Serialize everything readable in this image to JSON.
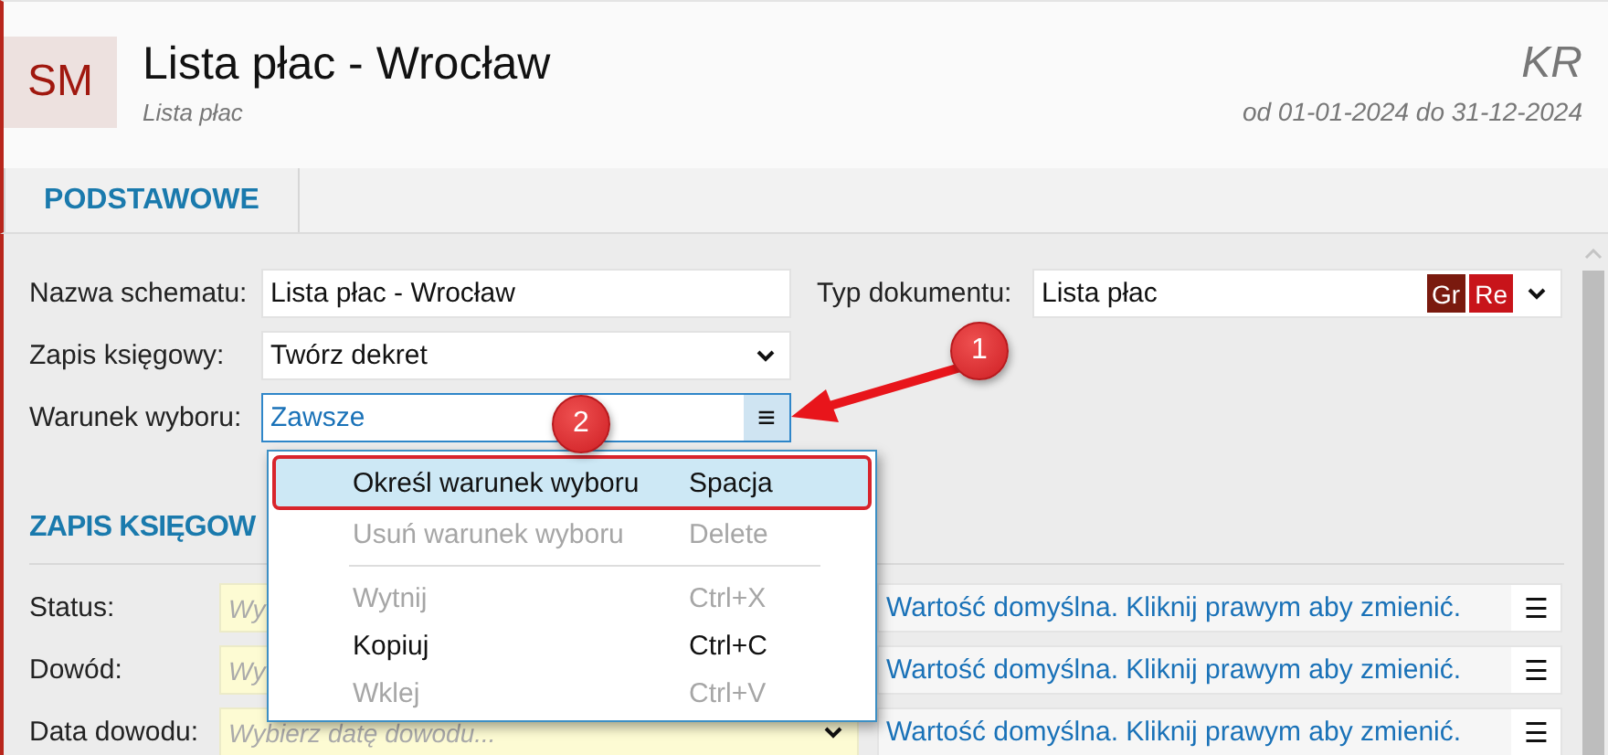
{
  "header": {
    "logo": "SM",
    "title": "Lista płac - Wrocław",
    "subtitle": "Lista płac",
    "code": "KR",
    "period": "od 01-01-2024 do 31-12-2024"
  },
  "tabs": [
    {
      "label": "PODSTAWOWE",
      "selected": true
    }
  ],
  "form": {
    "left": [
      {
        "label": "Nazwa schematu:",
        "kind": "text",
        "value": "Lista płac - Wrocław"
      },
      {
        "label": "Zapis księgowy:",
        "kind": "dropdown",
        "value": "Twórz dekret"
      },
      {
        "label": "Warunek wyboru:",
        "kind": "menu",
        "value": "Zawsze",
        "focused": true,
        "button": "≡"
      }
    ],
    "right": [
      {
        "label": "Typ dokumentu:",
        "kind": "dropdown",
        "value": "Lista płac",
        "tags": [
          {
            "text": "Gr",
            "color": "#7a1a0e"
          },
          {
            "text": "Re",
            "color": "#c8141a"
          }
        ]
      }
    ]
  },
  "section": {
    "title": "ZAPIS KSIĘGOW",
    "rows": [
      {
        "label": "Status:",
        "kind": "text",
        "placeholder": "Wy",
        "hint": "Wartość domyślna. Kliknij prawym aby zmienić.",
        "button": "☰"
      },
      {
        "label": "Dowód:",
        "kind": "text",
        "placeholder": "Wy",
        "hint": "Wartość domyślna. Kliknij prawym aby zmienić.",
        "button": "☰"
      },
      {
        "label": "Data dowodu:",
        "kind": "date",
        "placeholder": "Wybierz datę dowodu...",
        "hint": "Wartość domyślna. Kliknij prawym aby zmienić.",
        "button": "☰"
      }
    ]
  },
  "context_menu": {
    "items": [
      {
        "kind": "item",
        "label": "Określ warunek wyboru",
        "shortcut": "Spacja",
        "disabled": false,
        "selected": true
      },
      {
        "kind": "item",
        "label": "Usuń warunek wyboru",
        "shortcut": "Delete",
        "disabled": true,
        "selected": false
      },
      {
        "kind": "separator"
      },
      {
        "kind": "item",
        "label": "Wytnij",
        "shortcut": "Ctrl+X",
        "disabled": true,
        "selected": false
      },
      {
        "kind": "item",
        "label": "Kopiuj",
        "shortcut": "Ctrl+C",
        "disabled": false,
        "selected": false
      },
      {
        "kind": "item",
        "label": "Wklej",
        "shortcut": "Ctrl+V",
        "disabled": true,
        "selected": false
      }
    ]
  },
  "annotations": [
    {
      "text": "1",
      "kind": "arrow"
    },
    {
      "text": "2",
      "kind": "plain"
    }
  ]
}
